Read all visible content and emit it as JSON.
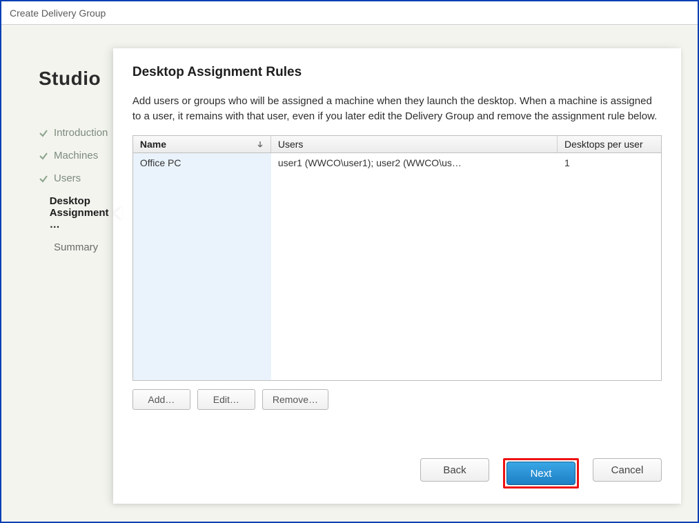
{
  "window": {
    "title": "Create Delivery Group"
  },
  "sidebar": {
    "brand": "Studio",
    "steps": [
      {
        "label": "Introduction",
        "state": "done"
      },
      {
        "label": "Machines",
        "state": "done"
      },
      {
        "label": "Users",
        "state": "done"
      },
      {
        "label": "Desktop Assignment …",
        "state": "current"
      },
      {
        "label": "Summary",
        "state": "pending"
      }
    ]
  },
  "panel": {
    "heading": "Desktop Assignment Rules",
    "description": "Add users or groups who will be assigned a machine when they launch the desktop. When a machine is assigned to a user, it remains with that user, even if you later edit the Delivery Group and remove the assignment rule below.",
    "columns": {
      "name": "Name",
      "users": "Users",
      "dpu": "Desktops per user"
    },
    "rows": [
      {
        "name": "Office PC",
        "users": "user1 (WWCO\\user1); user2 (WWCO\\us…",
        "dpu": "1"
      }
    ],
    "buttons": {
      "add": "Add…",
      "edit": "Edit…",
      "remove": "Remove…"
    }
  },
  "wizard": {
    "back": "Back",
    "next": "Next",
    "cancel": "Cancel"
  }
}
